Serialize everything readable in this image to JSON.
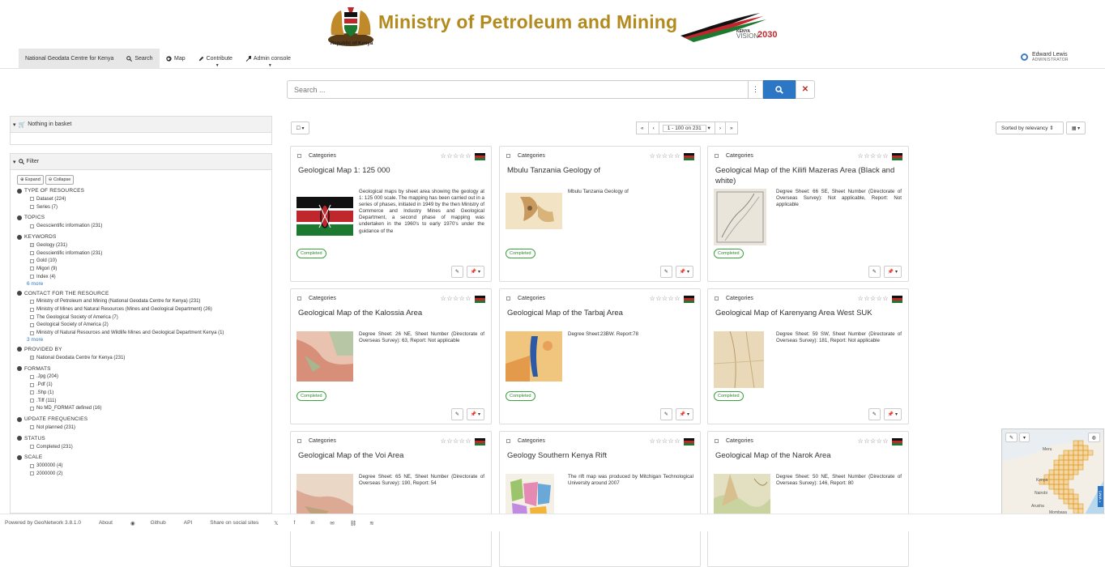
{
  "banner": {
    "ministry_title": "Ministry of Petroleum and Mining",
    "crest_caption": "Republic of Kenya",
    "vision_kenya": "KENYA",
    "vision_word": "VISION",
    "vision_year": "2030",
    "title_color": "#b38a1d"
  },
  "topnav": {
    "portal": "National Geodata Centre for Kenya",
    "search": "Search",
    "map": "Map",
    "contribute": "Contribute",
    "admin": "Admin console",
    "user_name": "Edward Lewis",
    "user_role": "ADMINISTRATOR"
  },
  "search": {
    "placeholder": "Search ..."
  },
  "basket": {
    "label": "Nothing in basket"
  },
  "filter": {
    "label": "Filter",
    "expand": "Expand",
    "collapse": "Collapse",
    "facets": [
      {
        "title": "TYPE OF RESOURCES",
        "items": [
          {
            "label": "Dataset (224)",
            "checked": false
          },
          {
            "label": "Series (7)",
            "checked": false
          }
        ]
      },
      {
        "title": "TOPICS",
        "items": [
          {
            "label": "Geoscientific information (231)",
            "checked": false
          }
        ]
      },
      {
        "title": "KEYWORDS",
        "items": [
          {
            "label": "Geology (231)",
            "checked": true
          },
          {
            "label": "Geoscientific information (231)",
            "checked": false
          },
          {
            "label": "Gold (10)",
            "checked": false
          },
          {
            "label": "Migori (9)",
            "checked": false
          },
          {
            "label": "Index (4)",
            "checked": false
          }
        ],
        "more": "6 more"
      },
      {
        "title": "CONTACT FOR THE RESOURCE",
        "items": [
          {
            "label": "Ministry of Petroleum and Mining (National Geodata Centre for Kenya) (231)",
            "checked": false
          },
          {
            "label": "Ministry of Mines and Natural Resources (Mines and Geological Department) (26)",
            "checked": false
          },
          {
            "label": "The Geological Society of America (7)",
            "checked": false
          },
          {
            "label": "Geological Society of America (2)",
            "checked": false
          },
          {
            "label": "Ministry of Natural Resources and Wildlife Mines and Geological Department Kenya (1)",
            "checked": false
          }
        ],
        "more": "3 more"
      },
      {
        "title": "PROVIDED BY",
        "items": [
          {
            "label": "National Geodata Centre for Kenya (231)",
            "checked": true
          }
        ]
      },
      {
        "title": "FORMATS",
        "items": [
          {
            "label": ".Jpg (204)",
            "checked": false
          },
          {
            "label": ".Pdf (1)",
            "checked": false
          },
          {
            "label": ".Shp (1)",
            "checked": false
          },
          {
            "label": ".Tiff (111)",
            "checked": false
          },
          {
            "label": "No MD_FORMAT defined (16)",
            "checked": false
          }
        ]
      },
      {
        "title": "UPDATE FREQUENCIES",
        "items": [
          {
            "label": "Not planned (231)",
            "checked": false
          }
        ]
      },
      {
        "title": "STATUS",
        "items": [
          {
            "label": "Completed (231)",
            "checked": false
          }
        ]
      },
      {
        "title": "SCALE",
        "items": [
          {
            "label": "3000000 (4)",
            "checked": false
          },
          {
            "label": "2000000 (2)",
            "checked": false
          }
        ]
      }
    ]
  },
  "results": {
    "pager_label": "1 - 100 on 231",
    "sort_label": "Sorted by relevancy",
    "category_label": "Categories",
    "stars": "☆☆☆☆☆",
    "cards": [
      {
        "title": "Geological Map 1: 125 000",
        "thumb": "kenya-flag",
        "desc": "Geological maps by sheet area showing the geology at 1: 125 000 scale. The mapping has been carried out in a series of phases, initiated in 1949 by the then Ministry of Commerce and Industry Mines and Geological Department, a second phase of mapping was undertaken in the 1960's to early 1970's under the guidance of the",
        "status": "Completed"
      },
      {
        "title": "Mbulu Tanzania Geology of",
        "thumb": "map-tan",
        "desc": "Mbulu Tanzania Geology of",
        "status": "Completed"
      },
      {
        "title": "Geological Map of the Kilifi Mazeras Area (Black and white)",
        "thumb": "map-bw",
        "desc": "Degree Sheet: 66 SE, Sheet Number (Directorate of Overseas Survey): Not applicable, Report: Not applicable",
        "status": "Completed"
      },
      {
        "title": "Geological Map of the Kalossia Area",
        "thumb": "map-red",
        "desc": "Degree Sheet: 26 NE, Sheet Number (Directorate of Overseas Survey): 63, Report: Not applicable",
        "status": "Completed"
      },
      {
        "title": "Geological Map of the Tarbaj Area",
        "thumb": "map-orange",
        "desc": "Degree Sheet:23BW. Report:78",
        "status": "Completed"
      },
      {
        "title": "Geological Map of Karenyang Area West SUK",
        "thumb": "map-beige",
        "desc": "Degree Sheet: 59 SW, Sheet Number (Directorate of Overseas Survey): 181, Report: Not applicable",
        "status": "Completed"
      },
      {
        "title": "Geological Map of the Voi Area",
        "thumb": "map-pink",
        "desc": "Degree Sheet: 65 NE, Sheet Number (Directorate of Overseas Survey): 190, Report: 54",
        "status": ""
      },
      {
        "title": "Geology Southern Kenya Rift",
        "thumb": "map-multi",
        "desc": "The rift map was produced by Mitchigan Technological University around 2007",
        "status": ""
      },
      {
        "title": "Geological Map of the Narok Area",
        "thumb": "map-green",
        "desc": "Degree Sheet: 50 NE, Sheet Number (Directorate of Overseas Survey): 146, Report: 80",
        "status": ""
      }
    ]
  },
  "minimap": {
    "places": [
      "Meru",
      "Kenya",
      "Nairobi",
      "Arusha",
      "Mombasa"
    ],
    "side_label": "+ WMS"
  },
  "footer": {
    "powered": "Powered by GeoNetwork 3.8.1.0",
    "about": "About",
    "github": "Github",
    "api": "API",
    "share": "Share on social sites"
  }
}
